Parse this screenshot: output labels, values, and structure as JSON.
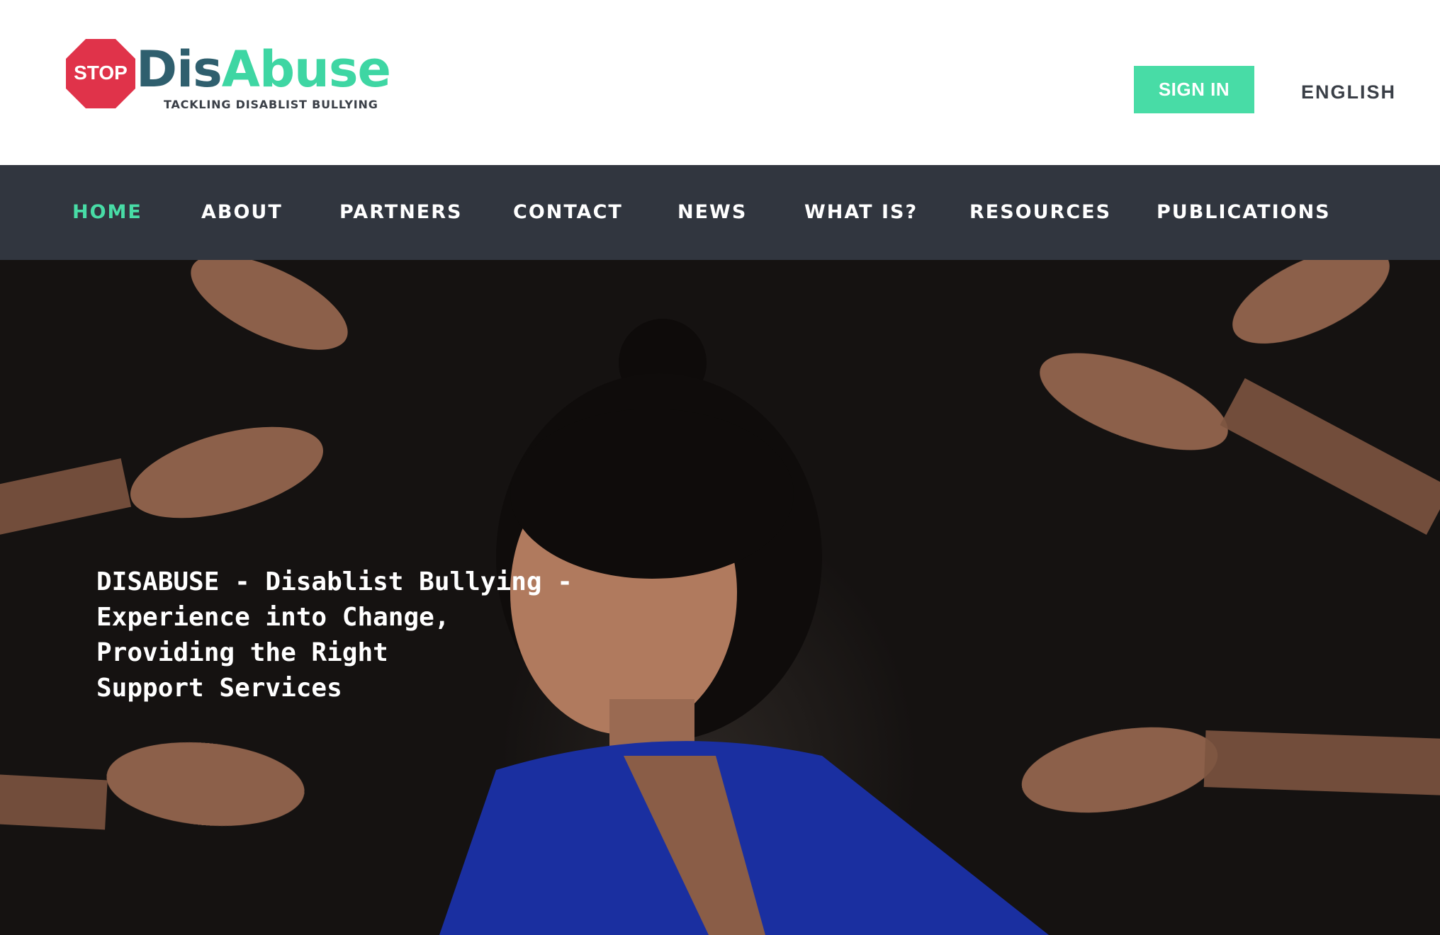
{
  "header": {
    "logo": {
      "stop_text": "STOP",
      "brand_part1": "Dis",
      "brand_part2": "Abuse",
      "tagline": "TACKLING DISABLIST BULLYING"
    },
    "sign_in_label": "SIGN IN",
    "language_label": "ENGLISH"
  },
  "nav": {
    "items": [
      {
        "label": "HOME",
        "active": true
      },
      {
        "label": "ABOUT"
      },
      {
        "label": "PARTNERS"
      },
      {
        "label": "CONTACT"
      },
      {
        "label": "NEWS"
      },
      {
        "label": "WHAT IS?"
      },
      {
        "label": "RESOURCES"
      },
      {
        "label": "PUBLICATIONS"
      }
    ]
  },
  "hero": {
    "title_lines": [
      "DISABUSE - Disablist Bullying -",
      "Experience into Change,",
      "Providing the Right",
      "Support Services"
    ]
  },
  "colors": {
    "accent": "#48dca6",
    "brand_dark": "#2f5f6e",
    "nav_bg": "#31363f",
    "stop_red": "#e0334a",
    "hero_bg": "#151211"
  }
}
